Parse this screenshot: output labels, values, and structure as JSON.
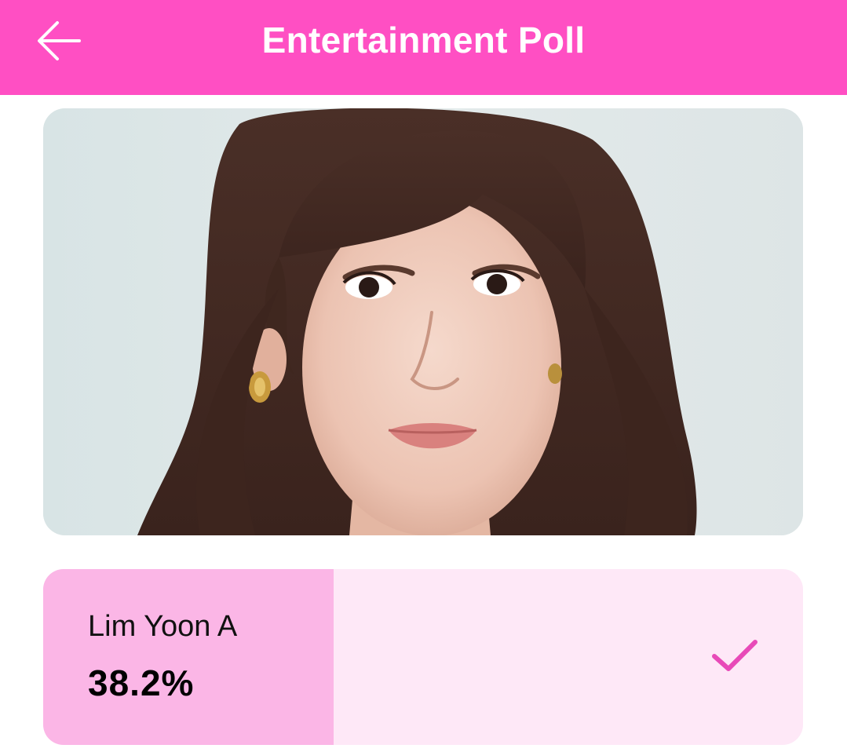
{
  "header": {
    "title": "Entertainment Poll",
    "back_icon": "arrow-left-icon",
    "background": "#ff4fc3"
  },
  "poll": {
    "option": {
      "name": "Lim Yoon A",
      "percent_label": "38.2%",
      "percent_value": 0.382,
      "selected": true,
      "check_icon": "checkmark-icon",
      "fill_color": "#fbb6e6",
      "track_color": "#fee8f7",
      "check_color": "#e84ab8"
    }
  }
}
